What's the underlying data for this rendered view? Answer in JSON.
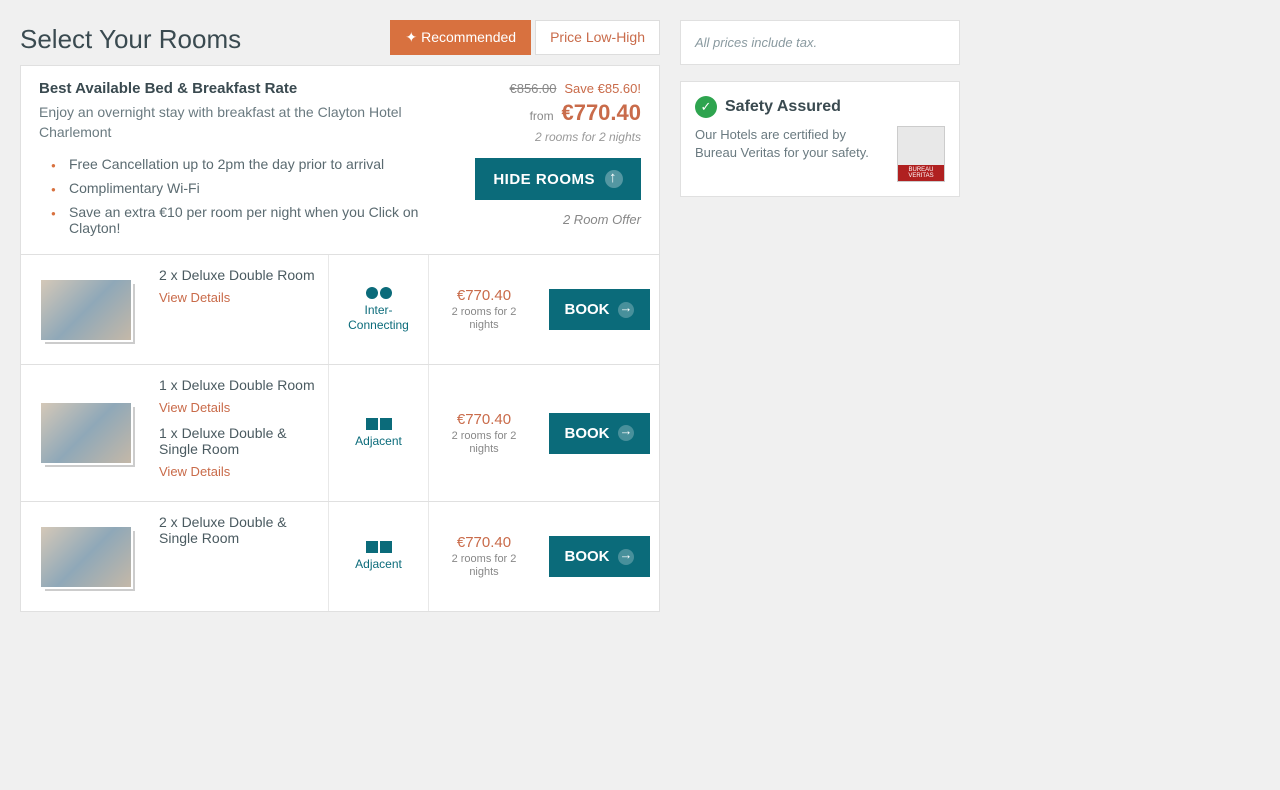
{
  "page": {
    "title": "Select Your Rooms"
  },
  "sortTabs": {
    "recommended": "Recommended",
    "priceLow": "Price Low-High"
  },
  "rate": {
    "title": "Best Available Bed & Breakfast Rate",
    "description": "Enjoy an overnight stay with breakfast at the Clayton Hotel Charlemont",
    "bullets": [
      "Free Cancellation up to 2pm the day prior to arrival",
      "Complimentary Wi-Fi",
      "Save an extra €10 per room per night when you Click on Clayton!"
    ],
    "origPrice": "€856.00",
    "saveAmount": "Save €85.60!",
    "fromLabel": "from",
    "price": "€770.40",
    "roomsNote": "2 rooms for 2 nights",
    "hideButton": "HIDE ROOMS",
    "offerLabel": "2 Room Offer"
  },
  "rooms": [
    {
      "name1": "2 x Deluxe Double Room",
      "view1": "View Details",
      "name2": "",
      "view2": "",
      "connType": "inter",
      "connLabel": "Inter-Connecting",
      "price": "€770.40",
      "note": "2 rooms for 2 nights",
      "book": "BOOK"
    },
    {
      "name1": "1 x Deluxe Double Room",
      "view1": "View Details",
      "name2": "1 x Deluxe Double & Single Room",
      "view2": "View Details",
      "connType": "adjacent",
      "connLabel": "Adjacent",
      "price": "€770.40",
      "note": "2 rooms for 2 nights",
      "book": "BOOK"
    },
    {
      "name1": "2 x Deluxe Double & Single Room",
      "view1": "",
      "name2": "",
      "view2": "",
      "connType": "adjacent",
      "connLabel": "Adjacent",
      "price": "€770.40",
      "note": "2 rooms for 2 nights",
      "book": "BOOK"
    }
  ],
  "sidebar": {
    "taxNote": "All prices include tax.",
    "safetyTitle": "Safety Assured",
    "safetyText": "Our Hotels are certified by Bureau Veritas for your safety."
  }
}
